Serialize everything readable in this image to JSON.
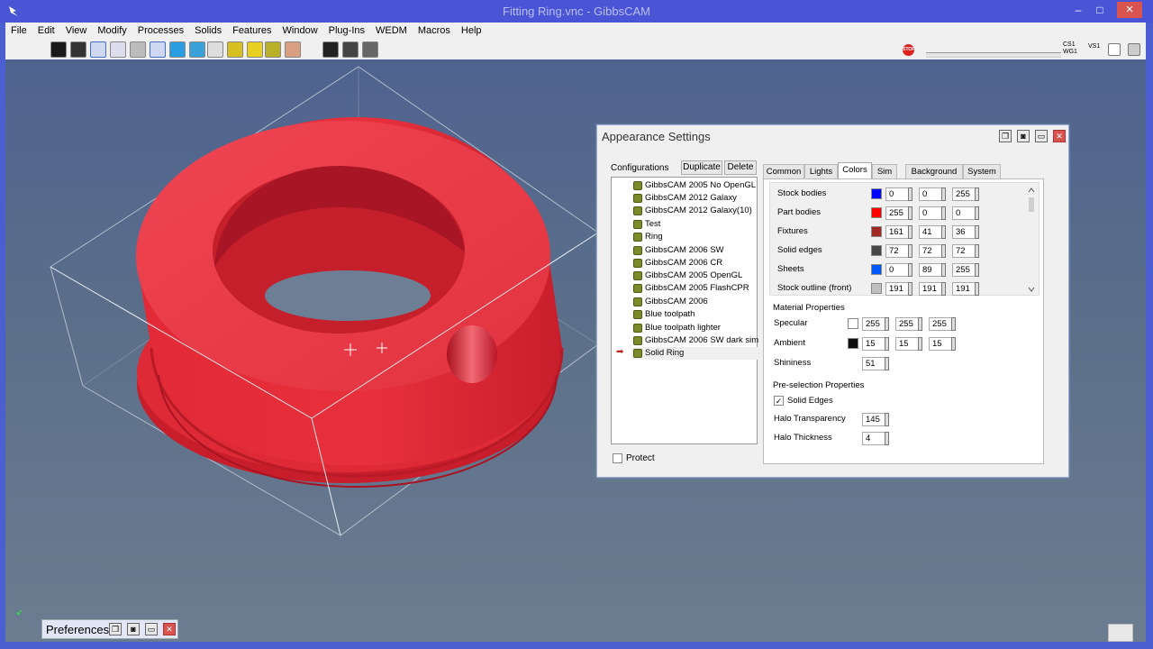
{
  "window": {
    "title": "Fitting Ring.vnc - GibbsCAM",
    "min": "–",
    "max": "□",
    "close": "×"
  },
  "menu": [
    "File",
    "Edit",
    "View",
    "Modify",
    "Processes",
    "Solids",
    "Features",
    "Window",
    "Plug-Ins",
    "WEDM",
    "Macros",
    "Help"
  ],
  "toolbar": {
    "stop_label": "STOP",
    "cs": "CS1",
    "wg": "WG1",
    "vs": "VS1"
  },
  "dialog": {
    "title": "Appearance Settings",
    "configurations_label": "Configurations",
    "duplicate": "Duplicate",
    "delete": "Delete",
    "configs": [
      "GibbsCAM 2005 No OpenGL",
      "GibbsCAM 2012 Galaxy",
      "GibbsCAM 2012 Galaxy(10)",
      "Test",
      "Ring",
      "GibbsCAM 2006 SW",
      "GibbsCAM 2006 CR",
      "GibbsCAM 2005 OpenGL",
      "GibbsCAM 2005 FlashCPR",
      "GibbsCAM 2006",
      "Blue toolpath",
      "Blue toolpath lighter",
      "GibbsCAM 2006 SW dark sim",
      "Solid Ring"
    ],
    "selected_config": "Solid Ring",
    "protect": "Protect",
    "tabs": [
      "Common",
      "Lights",
      "Colors",
      "Sim",
      "Background",
      "System"
    ],
    "active_tab": "Colors",
    "colors": [
      {
        "name": "Stock bodies",
        "color": "#0000ff",
        "r": "0",
        "g": "0",
        "b": "255"
      },
      {
        "name": "Part bodies",
        "color": "#ff0000",
        "r": "255",
        "g": "0",
        "b": "0"
      },
      {
        "name": "Fixtures",
        "color": "#a12924",
        "r": "161",
        "g": "41",
        "b": "36"
      },
      {
        "name": "Solid edges",
        "color": "#484848",
        "r": "72",
        "g": "72",
        "b": "72"
      },
      {
        "name": "Sheets",
        "color": "#0059ff",
        "r": "0",
        "g": "89",
        "b": "255"
      },
      {
        "name": "Stock outline (front)",
        "color": "#bfbfbf",
        "r": "191",
        "g": "191",
        "b": "191"
      }
    ],
    "material": {
      "header": "Material Properties",
      "specular": {
        "label": "Specular",
        "color": "#ffffff",
        "r": "255",
        "g": "255",
        "b": "255"
      },
      "ambient": {
        "label": "Ambient",
        "color": "#0f0f0f",
        "r": "15",
        "g": "15",
        "b": "15"
      },
      "shininess": {
        "label": "Shininess",
        "value": "51"
      }
    },
    "preselection": {
      "header": "Pre-selection Properties",
      "solid_edges": "Solid Edges",
      "halo_transparency": {
        "label": "Halo Transparency",
        "value": "145"
      },
      "halo_thickness": {
        "label": "Halo Thickness",
        "value": "4"
      }
    }
  },
  "preferences": {
    "label": "Preferences"
  },
  "accent": {
    "titlebar": "#4a55d6",
    "part": "#e8323f"
  }
}
